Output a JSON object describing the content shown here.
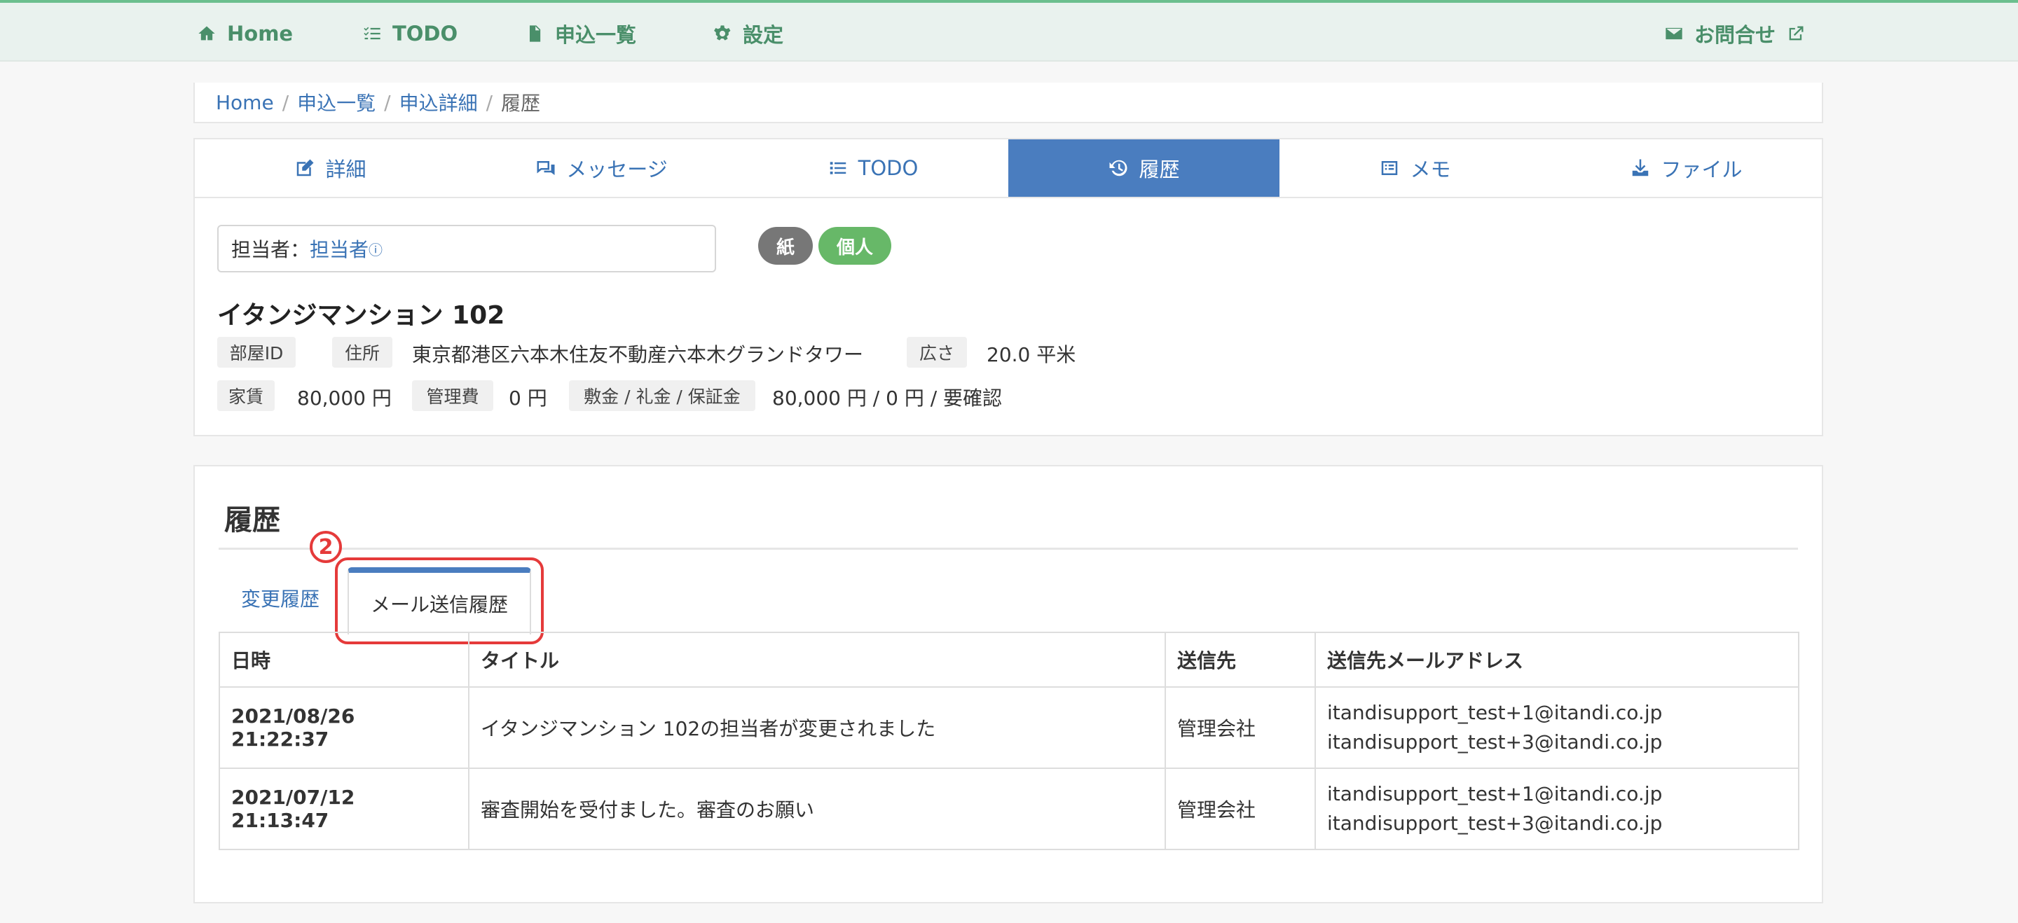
{
  "nav": {
    "home": "Home",
    "todo": "TODO",
    "applications": "申込一覧",
    "settings": "設定",
    "contact": "お問合せ"
  },
  "breadcrumb": {
    "home": "Home",
    "applications": "申込一覧",
    "detail": "申込詳細",
    "current": "履歴"
  },
  "tabs": [
    {
      "label": "詳細",
      "icon": "edit-icon"
    },
    {
      "label": "メッセージ",
      "icon": "comments-icon"
    },
    {
      "label": "TODO",
      "icon": "list-icon"
    },
    {
      "label": "履歴",
      "icon": "history-icon",
      "active": true
    },
    {
      "label": "メモ",
      "icon": "memo-icon"
    },
    {
      "label": "ファイル",
      "icon": "download-icon"
    }
  ],
  "assignee": {
    "label": "担当者：",
    "value": "担当者",
    "info_mark": "ⓘ"
  },
  "badges": {
    "paper": "紙",
    "individual": "個人",
    "paper_color": "#777777",
    "individual_color": "#67b868"
  },
  "property": {
    "title": "イタンジマンション 102",
    "room_id_label": "部屋ID",
    "address_label": "住所",
    "address": "東京都港区六本木住友不動産六本木グランドタワー",
    "area_label": "広さ",
    "area": "20.0 平米",
    "rent_label": "家賃",
    "rent": "80,000 円",
    "mgmt_fee_label": "管理費",
    "mgmt_fee": "0 円",
    "deposit_label": "敷金 / 礼金 / 保証金",
    "deposit": "80,000 円 / 0 円 / 要確認"
  },
  "history": {
    "title": "履歴",
    "subtab_changes": "変更履歴",
    "subtab_mail": "メール送信履歴",
    "step_marker": "2",
    "columns": [
      "日時",
      "タイトル",
      "送信先",
      "送信先メールアドレス"
    ],
    "rows": [
      {
        "datetime": "2021/08/26 21:22:37",
        "title": "イタンジマンション 102の担当者が変更されました",
        "recipient": "管理会社",
        "emails": [
          "itandisupport_test+1@itandi.co.jp",
          "itandisupport_test+3@itandi.co.jp"
        ]
      },
      {
        "datetime": "2021/07/12 21:13:47",
        "title": "審査開始を受付ました。審査のお願い",
        "recipient": "管理会社",
        "emails": [
          "itandisupport_test+1@itandi.co.jp",
          "itandisupport_test+3@itandi.co.jp"
        ]
      }
    ]
  }
}
